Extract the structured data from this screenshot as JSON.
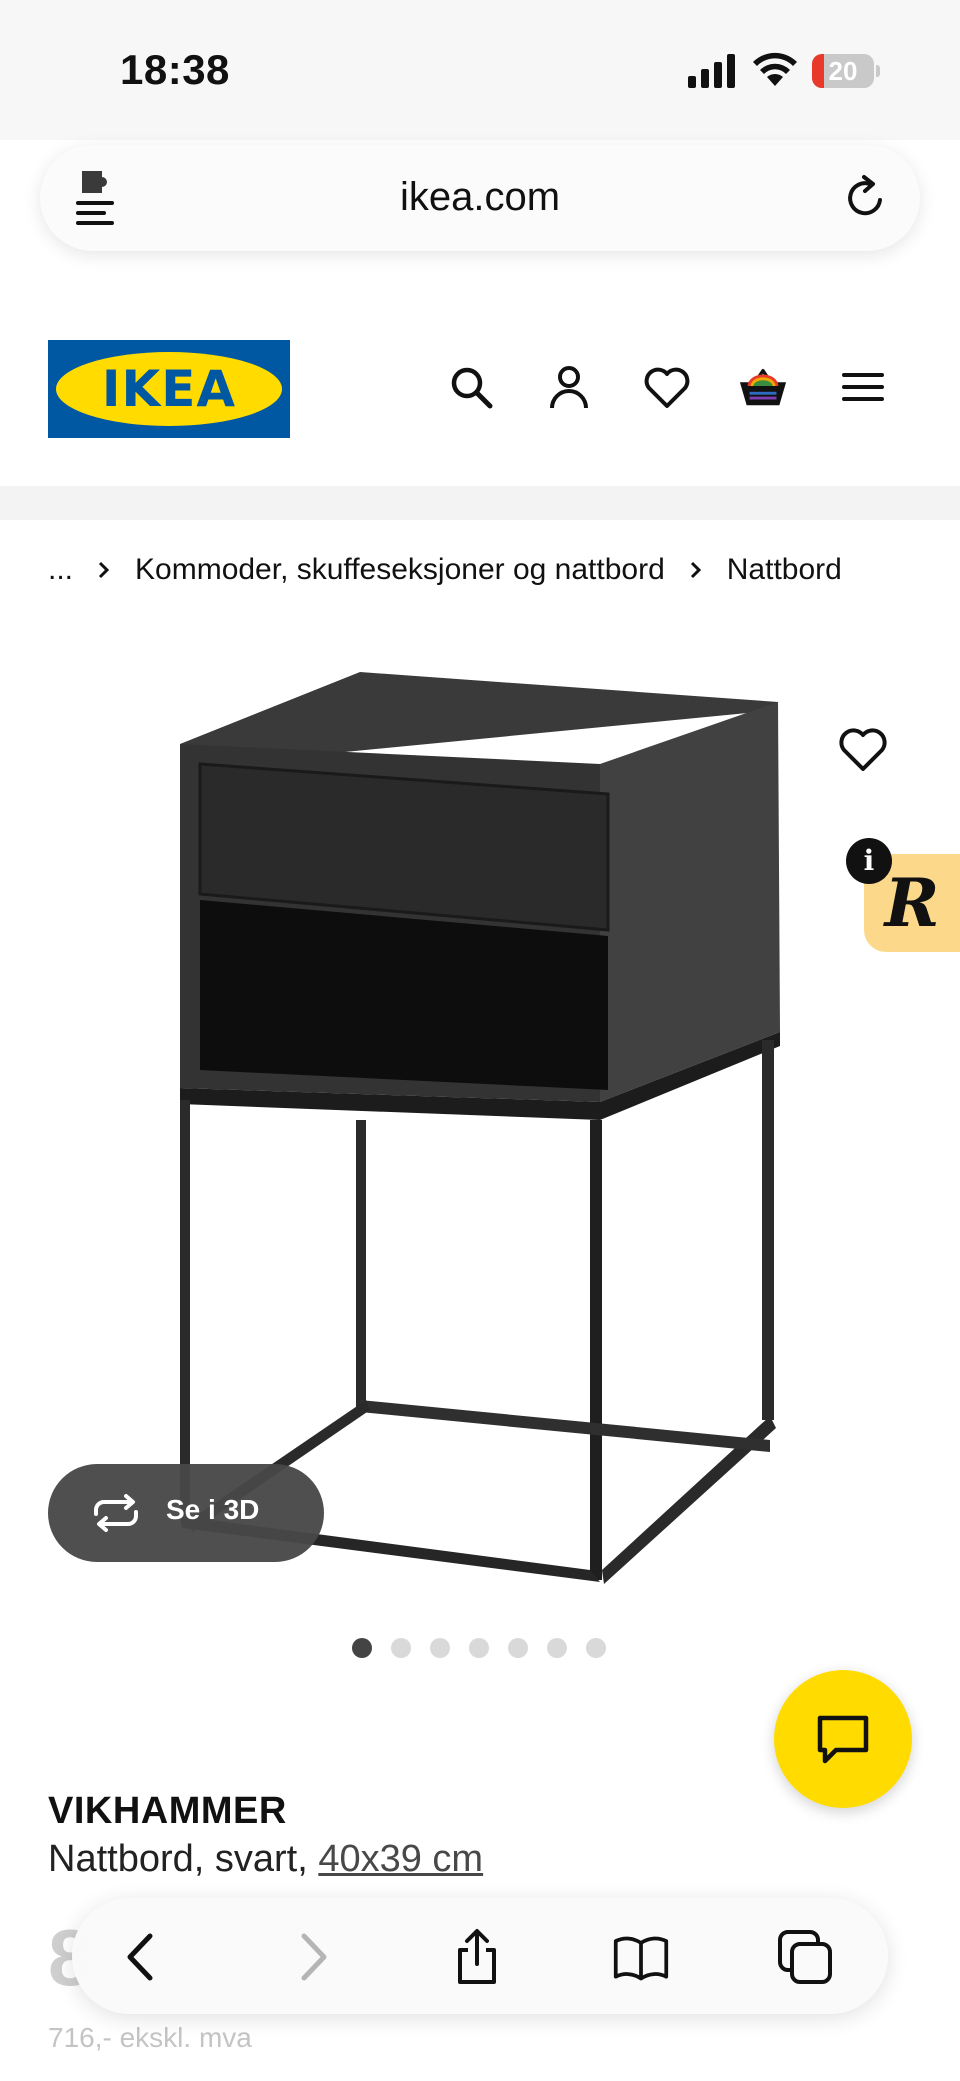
{
  "status_bar": {
    "time": "18:38",
    "battery_level": "20",
    "battery_fraction": 0.2,
    "battery_color": "#e8392b"
  },
  "browser": {
    "url": "ikea.com",
    "icons": [
      "extension-icon",
      "reload-icon"
    ]
  },
  "header": {
    "logo_text": "IKEA",
    "brand_colors": {
      "blue": "#0058a3",
      "yellow": "#ffdb00"
    },
    "icons": [
      "search-icon",
      "user-icon",
      "heart-icon",
      "cart-icon",
      "menu-icon"
    ]
  },
  "breadcrumb": {
    "ellipsis": "...",
    "items": [
      "Kommoder, skuffeseksjoner og nattbord",
      "Nattbord"
    ]
  },
  "gallery": {
    "view_3d_label": "Se i 3D",
    "image_count": 7,
    "active_index": 0
  },
  "product": {
    "name": "VIKHAMMER",
    "description_prefix": "Nattbord, svart, ",
    "size_link": "40x39 cm",
    "price_partial": "8",
    "price_ex_vat": "716,- ekskl. mva"
  },
  "toolbar": {
    "icons": [
      "back-icon",
      "forward-icon",
      "share-icon",
      "bookmarks-icon",
      "tabs-icon"
    ]
  }
}
